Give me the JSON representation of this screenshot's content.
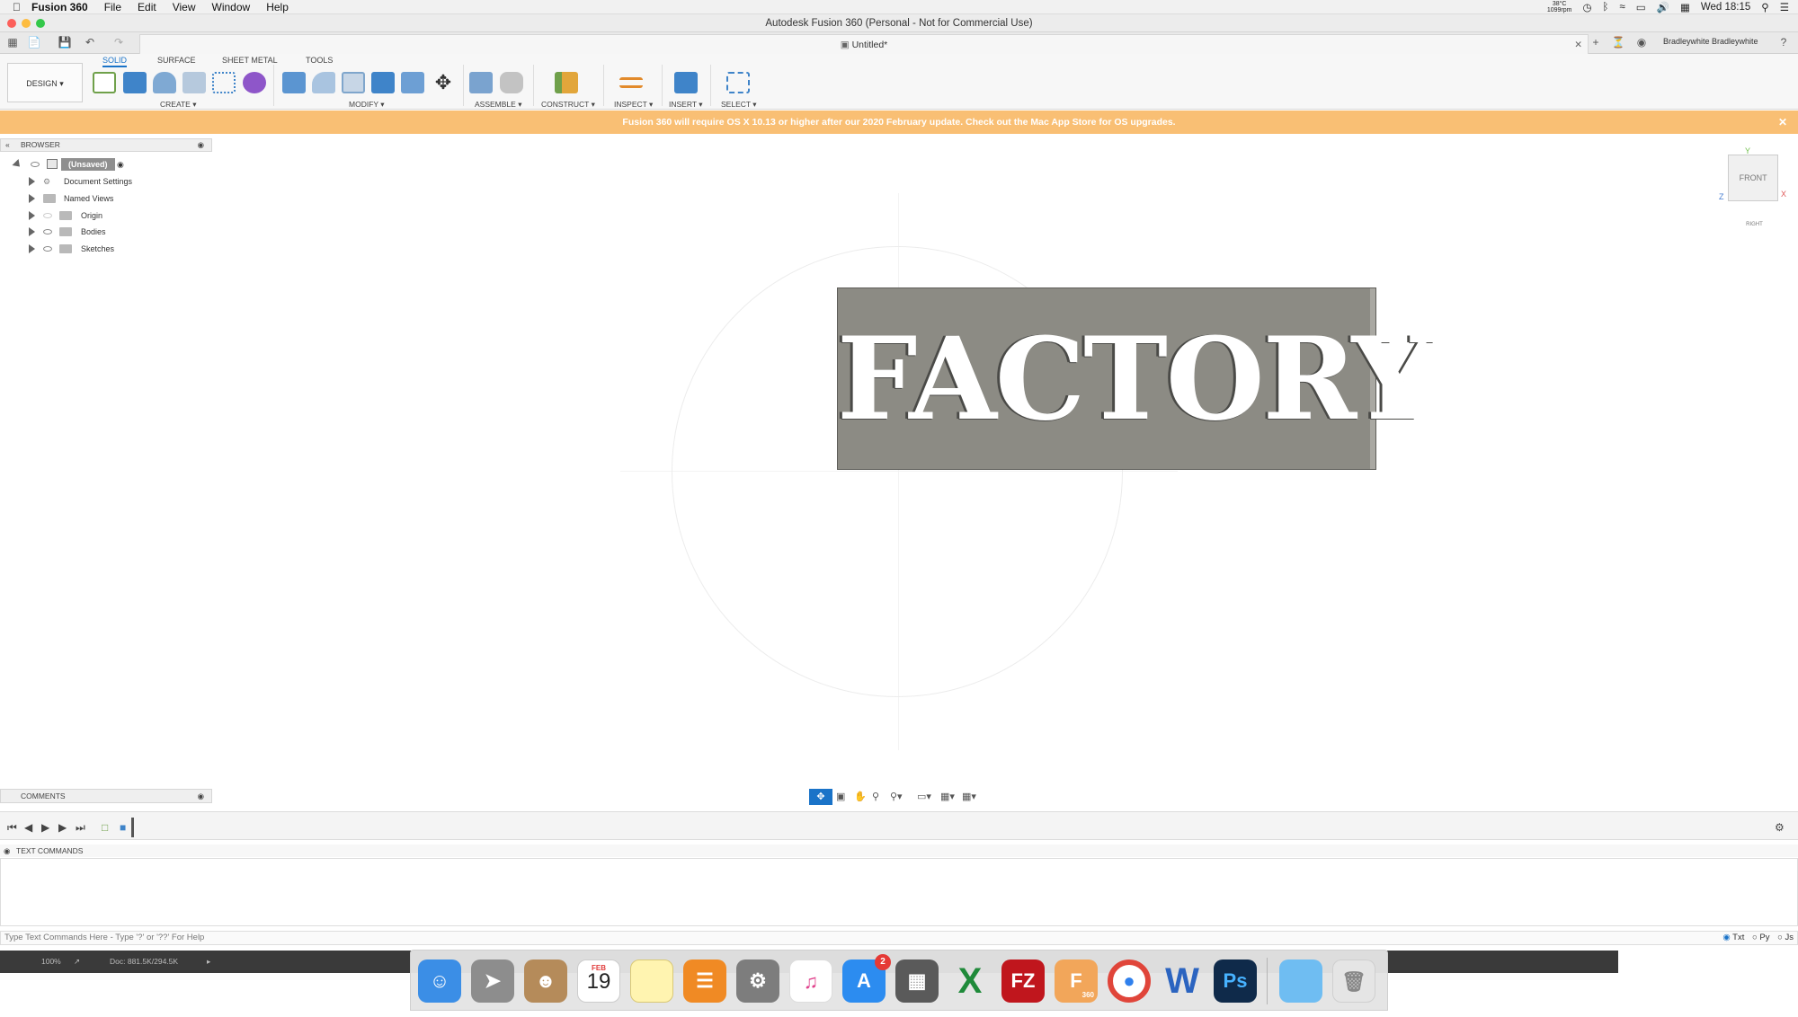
{
  "menubar": {
    "app_name": "Fusion 360",
    "items": [
      "File",
      "Edit",
      "View",
      "Window",
      "Help"
    ],
    "temperature": "38°C",
    "fan_speed": "1099rpm",
    "clock": "Wed 18:15"
  },
  "window": {
    "title": "Autodesk Fusion 360 (Personal - Not for Commercial Use)"
  },
  "document": {
    "tab_title": "Untitled*",
    "user_name": "Bradleywhite Bradleywhite"
  },
  "ribbon": {
    "tabs": [
      "SOLID",
      "SURFACE",
      "SHEET METAL",
      "TOOLS"
    ],
    "active_tab": "SOLID",
    "workspace": "DESIGN",
    "groups": {
      "create": "CREATE",
      "modify": "MODIFY",
      "assemble": "ASSEMBLE",
      "construct": "CONSTRUCT",
      "inspect": "INSPECT",
      "insert": "INSERT",
      "select": "SELECT"
    }
  },
  "banner": {
    "message": "Fusion 360 will require OS X 10.13 or higher after our 2020 February update. Check out the Mac App Store for OS upgrades."
  },
  "browser": {
    "title": "BROWSER",
    "root": "(Unsaved)",
    "items": [
      "Document Settings",
      "Named Views",
      "Origin",
      "Bodies",
      "Sketches"
    ]
  },
  "viewport": {
    "model_text": "FACTORY",
    "viewcube_face": "FRONT",
    "viewcube_right": "RIGHT",
    "axis_x": "X",
    "axis_y": "Y",
    "axis_z": "Z"
  },
  "comments": {
    "title": "COMMENTS"
  },
  "text_commands": {
    "title": "TEXT COMMANDS",
    "placeholder": "Type Text Commands Here - Type '?' or '??' For Help",
    "modes": [
      "Txt",
      "Py",
      "Js"
    ],
    "selected_mode": "Txt"
  },
  "status": {
    "zoom": "100%",
    "doc_info": "Doc: 881.5K/294.5K"
  },
  "dock": {
    "calendar_month": "FEB",
    "calendar_day": "19",
    "appstore_badge": "2",
    "fusion_label": "360"
  },
  "colors": {
    "banner_bg": "#f9bf74",
    "accent_blue": "#1a73c8",
    "plate": "#8c8b84"
  }
}
